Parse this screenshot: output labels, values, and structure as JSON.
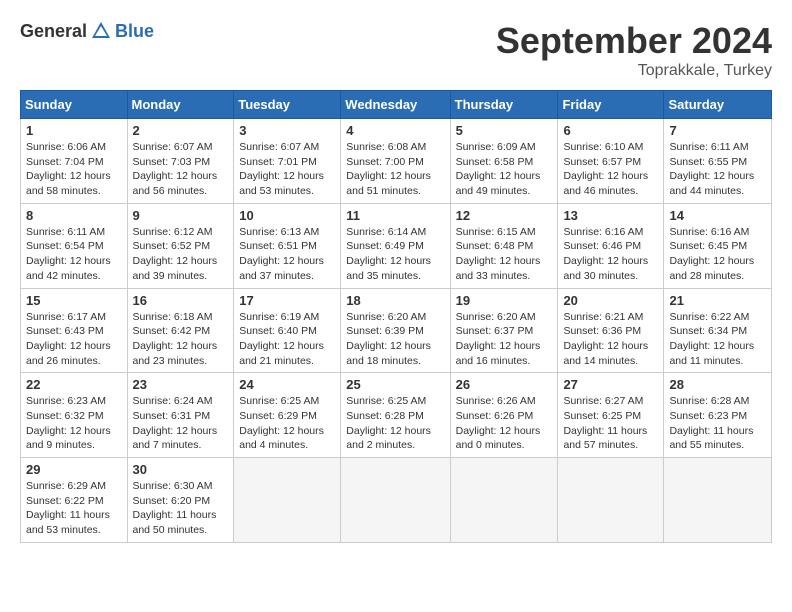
{
  "header": {
    "logo_general": "General",
    "logo_blue": "Blue",
    "month_title": "September 2024",
    "location": "Toprakkale, Turkey"
  },
  "calendar": {
    "headers": [
      "Sunday",
      "Monday",
      "Tuesday",
      "Wednesday",
      "Thursday",
      "Friday",
      "Saturday"
    ],
    "weeks": [
      [
        {
          "day": "1",
          "info": "Sunrise: 6:06 AM\nSunset: 7:04 PM\nDaylight: 12 hours\nand 58 minutes."
        },
        {
          "day": "2",
          "info": "Sunrise: 6:07 AM\nSunset: 7:03 PM\nDaylight: 12 hours\nand 56 minutes."
        },
        {
          "day": "3",
          "info": "Sunrise: 6:07 AM\nSunset: 7:01 PM\nDaylight: 12 hours\nand 53 minutes."
        },
        {
          "day": "4",
          "info": "Sunrise: 6:08 AM\nSunset: 7:00 PM\nDaylight: 12 hours\nand 51 minutes."
        },
        {
          "day": "5",
          "info": "Sunrise: 6:09 AM\nSunset: 6:58 PM\nDaylight: 12 hours\nand 49 minutes."
        },
        {
          "day": "6",
          "info": "Sunrise: 6:10 AM\nSunset: 6:57 PM\nDaylight: 12 hours\nand 46 minutes."
        },
        {
          "day": "7",
          "info": "Sunrise: 6:11 AM\nSunset: 6:55 PM\nDaylight: 12 hours\nand 44 minutes."
        }
      ],
      [
        {
          "day": "8",
          "info": "Sunrise: 6:11 AM\nSunset: 6:54 PM\nDaylight: 12 hours\nand 42 minutes."
        },
        {
          "day": "9",
          "info": "Sunrise: 6:12 AM\nSunset: 6:52 PM\nDaylight: 12 hours\nand 39 minutes."
        },
        {
          "day": "10",
          "info": "Sunrise: 6:13 AM\nSunset: 6:51 PM\nDaylight: 12 hours\nand 37 minutes."
        },
        {
          "day": "11",
          "info": "Sunrise: 6:14 AM\nSunset: 6:49 PM\nDaylight: 12 hours\nand 35 minutes."
        },
        {
          "day": "12",
          "info": "Sunrise: 6:15 AM\nSunset: 6:48 PM\nDaylight: 12 hours\nand 33 minutes."
        },
        {
          "day": "13",
          "info": "Sunrise: 6:16 AM\nSunset: 6:46 PM\nDaylight: 12 hours\nand 30 minutes."
        },
        {
          "day": "14",
          "info": "Sunrise: 6:16 AM\nSunset: 6:45 PM\nDaylight: 12 hours\nand 28 minutes."
        }
      ],
      [
        {
          "day": "15",
          "info": "Sunrise: 6:17 AM\nSunset: 6:43 PM\nDaylight: 12 hours\nand 26 minutes."
        },
        {
          "day": "16",
          "info": "Sunrise: 6:18 AM\nSunset: 6:42 PM\nDaylight: 12 hours\nand 23 minutes."
        },
        {
          "day": "17",
          "info": "Sunrise: 6:19 AM\nSunset: 6:40 PM\nDaylight: 12 hours\nand 21 minutes."
        },
        {
          "day": "18",
          "info": "Sunrise: 6:20 AM\nSunset: 6:39 PM\nDaylight: 12 hours\nand 18 minutes."
        },
        {
          "day": "19",
          "info": "Sunrise: 6:20 AM\nSunset: 6:37 PM\nDaylight: 12 hours\nand 16 minutes."
        },
        {
          "day": "20",
          "info": "Sunrise: 6:21 AM\nSunset: 6:36 PM\nDaylight: 12 hours\nand 14 minutes."
        },
        {
          "day": "21",
          "info": "Sunrise: 6:22 AM\nSunset: 6:34 PM\nDaylight: 12 hours\nand 11 minutes."
        }
      ],
      [
        {
          "day": "22",
          "info": "Sunrise: 6:23 AM\nSunset: 6:32 PM\nDaylight: 12 hours\nand 9 minutes."
        },
        {
          "day": "23",
          "info": "Sunrise: 6:24 AM\nSunset: 6:31 PM\nDaylight: 12 hours\nand 7 minutes."
        },
        {
          "day": "24",
          "info": "Sunrise: 6:25 AM\nSunset: 6:29 PM\nDaylight: 12 hours\nand 4 minutes."
        },
        {
          "day": "25",
          "info": "Sunrise: 6:25 AM\nSunset: 6:28 PM\nDaylight: 12 hours\nand 2 minutes."
        },
        {
          "day": "26",
          "info": "Sunrise: 6:26 AM\nSunset: 6:26 PM\nDaylight: 12 hours\nand 0 minutes."
        },
        {
          "day": "27",
          "info": "Sunrise: 6:27 AM\nSunset: 6:25 PM\nDaylight: 11 hours\nand 57 minutes."
        },
        {
          "day": "28",
          "info": "Sunrise: 6:28 AM\nSunset: 6:23 PM\nDaylight: 11 hours\nand 55 minutes."
        }
      ],
      [
        {
          "day": "29",
          "info": "Sunrise: 6:29 AM\nSunset: 6:22 PM\nDaylight: 11 hours\nand 53 minutes."
        },
        {
          "day": "30",
          "info": "Sunrise: 6:30 AM\nSunset: 6:20 PM\nDaylight: 11 hours\nand 50 minutes."
        },
        {
          "day": "",
          "info": ""
        },
        {
          "day": "",
          "info": ""
        },
        {
          "day": "",
          "info": ""
        },
        {
          "day": "",
          "info": ""
        },
        {
          "day": "",
          "info": ""
        }
      ]
    ]
  }
}
